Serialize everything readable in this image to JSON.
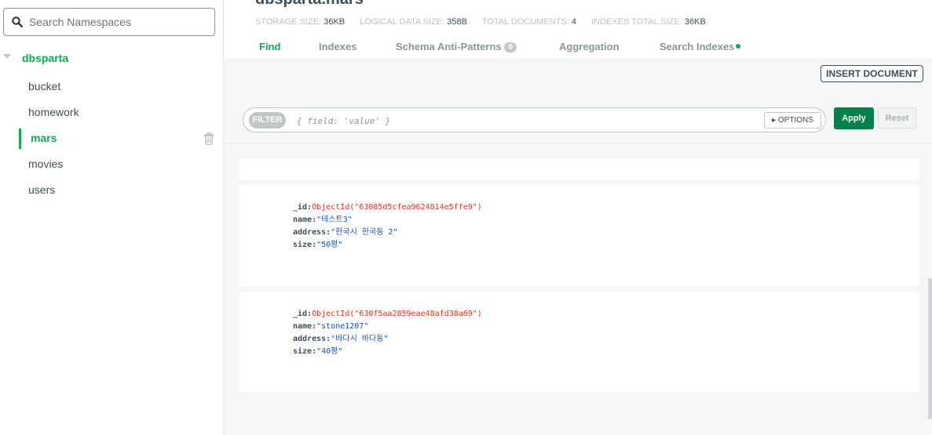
{
  "sidebar": {
    "search_placeholder": "Search Namespaces",
    "database": "dbsparta",
    "collections": [
      {
        "label": "bucket"
      },
      {
        "label": "homework"
      },
      {
        "label": "mars"
      },
      {
        "label": "movies"
      },
      {
        "label": "users"
      }
    ],
    "active_collection": "mars"
  },
  "header": {
    "title": "dbsparta.mars",
    "stats": [
      {
        "label": "STORAGE SIZE:",
        "value": "36KB"
      },
      {
        "label": "LOGICAL DATA SIZE:",
        "value": "358B"
      },
      {
        "label": "TOTAL DOCUMENTS:",
        "value": "4"
      },
      {
        "label": "INDEXES TOTAL SIZE:",
        "value": "36KB"
      }
    ],
    "tabs": [
      {
        "label": "Find"
      },
      {
        "label": "Indexes"
      },
      {
        "label": "Schema Anti-Patterns",
        "badge": "0"
      },
      {
        "label": "Aggregation"
      },
      {
        "label": "Search Indexes"
      }
    ]
  },
  "toolbar": {
    "insert_label": "INSERT DOCUMENT",
    "filter_label": "FILTER",
    "filter_placeholder": "{ field: 'value' }",
    "options_label": "▸ OPTIONS",
    "apply_label": "Apply",
    "reset_label": "Reset"
  },
  "documents": [
    {
      "id_key": "_id:",
      "id_value": "ObjectId(\"63085d5cfea9624814e5ffe9\")",
      "name_key": "name:",
      "name_value": "\"테스트3\"",
      "address_key": "address:",
      "address_value": "\"한국시 한국동 2\"",
      "size_key": "size:",
      "size_value": "\"50평\""
    },
    {
      "id_key": "_id:",
      "id_value": "ObjectId(\"630f5aa2859eae48afd38a69\")",
      "name_key": "name:",
      "name_value": "\"stone1207\"",
      "address_key": "address:",
      "address_value": "\"바다시 바다동\"",
      "size_key": "size:",
      "size_value": "\"40평\""
    }
  ],
  "colors": {
    "accent": "#13aa52",
    "apply_button": "#09804c",
    "objectid": "#cf3d23",
    "string": "#1254b7"
  }
}
